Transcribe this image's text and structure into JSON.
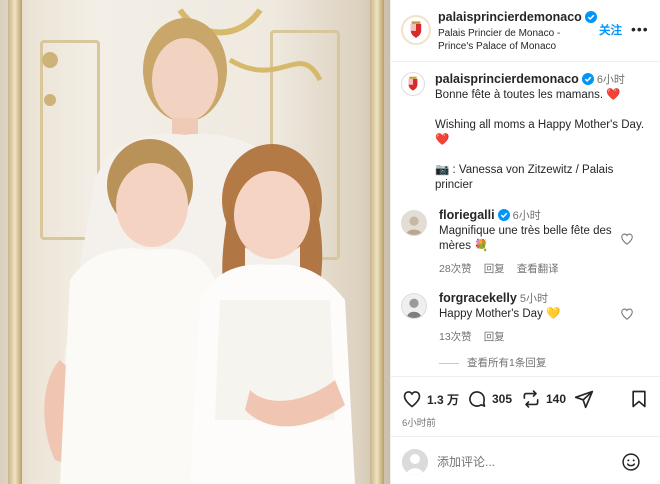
{
  "post": {
    "account": "palaisprincierdemonaco",
    "account_subtitle": "Palais Princier de Monaco - Prince's Palace of Monaco",
    "follow_label": "关注",
    "caption_time": "6小时",
    "caption_lines": [
      "Bonne fête à toutes les mamans. ",
      "Wishing all moms a Happy Mother's Day. ",
      "📷 : Vanessa von Zitzewitz / Palais princier"
    ],
    "caption_heart": "❤️"
  },
  "comments": [
    {
      "user": "floriegalli",
      "time": "6小时",
      "text": "Magnifique une très belle fête des mères 💐",
      "likes": "28次赞",
      "reply": "回复",
      "translate": "查看翻译",
      "verified": true
    },
    {
      "user": "forgracekelly",
      "time": "5小时",
      "text": "Happy Mother's Day 💛",
      "likes": "13次赞",
      "reply": "回复",
      "verified": false
    }
  ],
  "view_all_replies": "查看所有1条回复",
  "actions": {
    "likes": "1.3 万",
    "comments": "305",
    "reposts": "140"
  },
  "time_ago": "6小时前",
  "comment_input": {
    "placeholder": "添加评论..."
  },
  "colors": {
    "link_blue": "#0095f6",
    "verified_blue": "#0095f6",
    "heart_red": "#ed4956",
    "muted": "#737373"
  },
  "icons": [
    "verified-badge-icon",
    "more-icon",
    "heart-icon",
    "comment-icon",
    "repost-icon",
    "share-icon",
    "save-icon",
    "emoji-icon"
  ]
}
